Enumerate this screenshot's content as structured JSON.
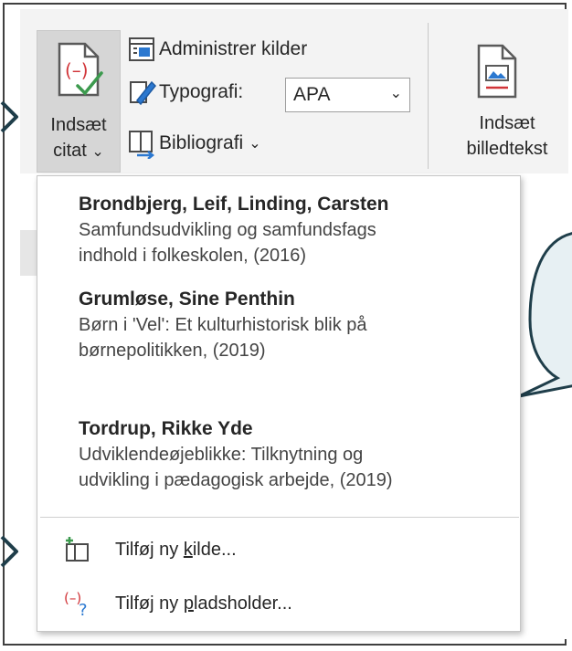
{
  "ribbon": {
    "insert_citation_label_1": "Indsæt",
    "insert_citation_label_2": "citat",
    "insert_citation_chevron": "⌄",
    "manage_sources_label": "Administrer kilder",
    "style_label": "Typografi:",
    "style_value": "APA",
    "style_chevron": "⌄",
    "bibliography_label": "Bibliografi",
    "bibliography_chevron": "⌄",
    "insert_caption_label_1": "Indsæt",
    "insert_caption_label_2": "billedtekst"
  },
  "menu": {
    "sources": [
      {
        "author": "Brondbjerg, Leif,  Linding, Carsten",
        "desc_1": "Samfundsudvikling og samfundsfags",
        "desc_2": "indhold i folkeskolen, (2016)"
      },
      {
        "author": "Grumløse, Sine Penthin",
        "desc_1": "Børn i 'Vel': Et kulturhistorisk blik på",
        "desc_2": "børnepolitikken, (2019)"
      },
      {
        "author": "Tordrup, Rikke Yde",
        "desc_1": "Udviklendeøjeblikke: Tilknytning og",
        "desc_2": "udvikling i pædagogisk arbejde, (2019)"
      }
    ],
    "add_source": {
      "pre": "Tilføj ny ",
      "ul": "k",
      "post": "ilde..."
    },
    "add_placeholder": {
      "pre": "Tilføj ny ",
      "ul": "p",
      "post": "ladsholder..."
    }
  },
  "colors": {
    "accent_red": "#d13438",
    "accent_green": "#3c9a4e",
    "accent_blue": "#2b78d0",
    "bubble_fill": "#e7f0f3",
    "bubble_stroke": "#1f3e4a"
  },
  "icons": [
    "insert-citation-icon",
    "manage-sources-icon",
    "style-brush-icon",
    "bibliography-icon",
    "insert-caption-icon",
    "add-source-icon",
    "add-placeholder-icon",
    "pointer-arrow-icon",
    "speech-bubble-icon"
  ]
}
